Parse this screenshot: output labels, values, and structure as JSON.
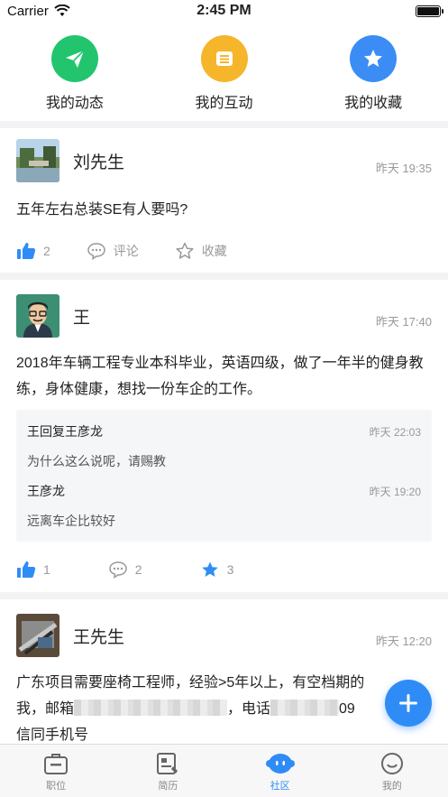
{
  "status_bar": {
    "carrier": "Carrier",
    "time": "2:45 PM"
  },
  "quick_nav": [
    {
      "label": "我的动态",
      "icon": "paper-plane-icon",
      "color": "#22c56e"
    },
    {
      "label": "我的互动",
      "icon": "interaction-icon",
      "color": "#f5b62b"
    },
    {
      "label": "我的收藏",
      "icon": "star-icon",
      "color": "#3b8df5"
    }
  ],
  "posts": [
    {
      "author": "刘先生",
      "time": "昨天 19:35",
      "content": "五年左右总装SE有人要吗?",
      "likes": "2",
      "comment_label": "评论",
      "favorite_label": "收藏"
    },
    {
      "author": "王",
      "time": "昨天 17:40",
      "content": "2018年车辆工程专业本科毕业，英语四级，做了一年半的健身教练，身体健康，想找一份车企的工作。",
      "replies": [
        {
          "author": "王回复王彦龙",
          "time": "昨天 22:03",
          "text": "为什么这么说呢，请赐教"
        },
        {
          "author": "王彦龙",
          "time": "昨天 19:20",
          "text": "远离车企比较好"
        }
      ],
      "likes": "1",
      "comments": "2",
      "favorites": "3"
    },
    {
      "author": "王先生",
      "time": "昨天 12:20",
      "content_line1": "广东项目需要座椅工程师，经验>5年以上，有空档期的",
      "content_line2_prefix": "我，邮箱",
      "content_line2_mid": "，电话",
      "content_line2_tail": "09",
      "content_line3": "信同手机号"
    }
  ],
  "tabs": [
    {
      "label": "职位",
      "icon": "briefcase-icon"
    },
    {
      "label": "简历",
      "icon": "resume-icon"
    },
    {
      "label": "社区",
      "icon": "community-icon",
      "active": true
    },
    {
      "label": "我的",
      "icon": "profile-icon"
    }
  ],
  "colors": {
    "accent": "#2f8cf6",
    "green": "#22c56e",
    "yellow": "#f5b62b"
  }
}
